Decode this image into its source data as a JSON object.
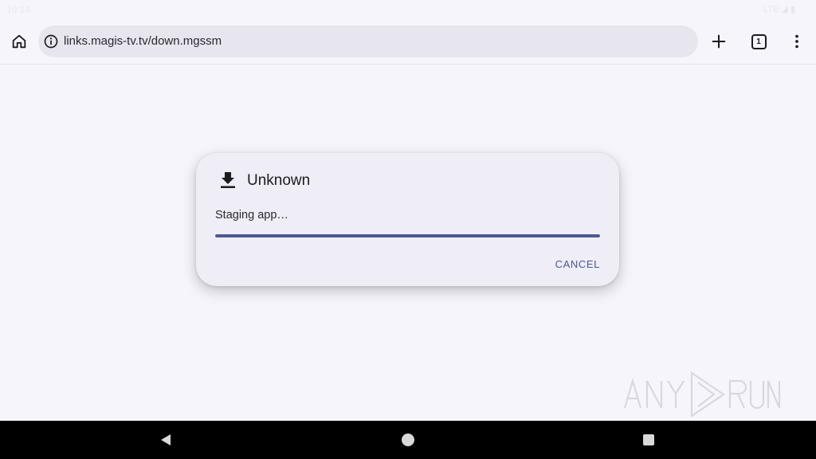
{
  "status_bar": {
    "time": "10:14",
    "right": "LTE ◢ ▮"
  },
  "browser": {
    "url": "links.magis-tv.tv/down.mgssm",
    "tab_count": "1",
    "icons": [
      "home-icon",
      "site-info-icon",
      "new-tab-plus-icon",
      "tab-switcher-icon",
      "overflow-menu-icon"
    ]
  },
  "dialog": {
    "title": "Unknown",
    "message": "Staging app…",
    "progress": 1.0,
    "cancel_label": "CANCEL",
    "icon": "download-icon",
    "accent_color": "#4a5a92"
  },
  "watermark": {
    "text_left": "ANY",
    "text_right": "RUN"
  },
  "nav_bar": {
    "icons": [
      "back-icon",
      "home-circle-icon",
      "recents-icon"
    ]
  }
}
